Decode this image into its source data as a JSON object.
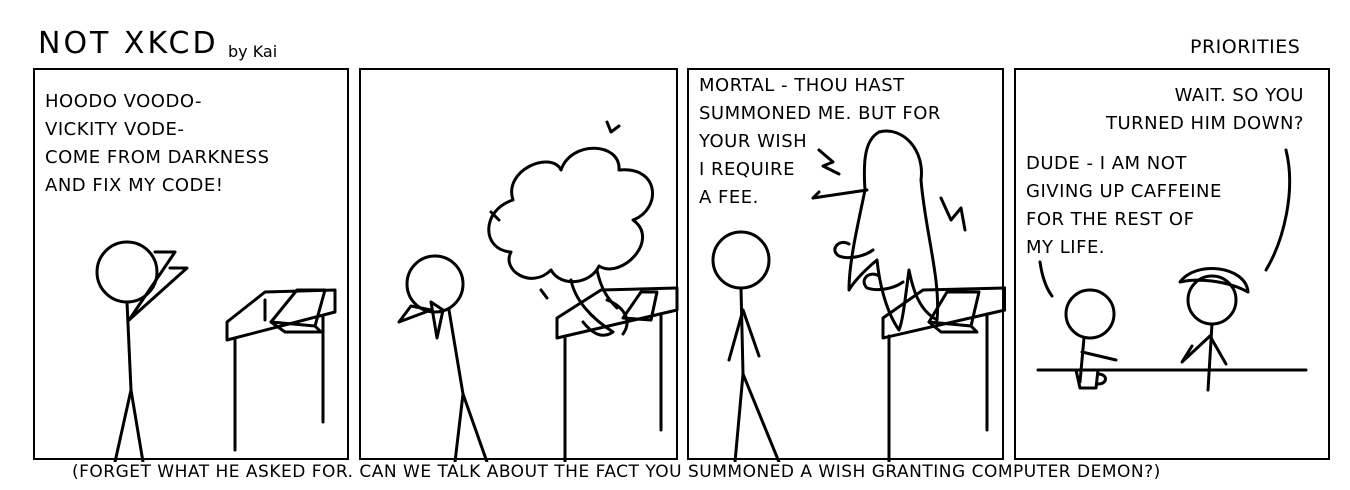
{
  "header": {
    "comic_title": "NOT XKCD",
    "author": "by Kai",
    "strip_title": "PRIORITIES"
  },
  "panels": [
    {
      "caption": "HOODO VOODO-\nVICKITY VODE-\nCOME FROM DARKNESS\nAND FIX MY  CODE!"
    },
    {
      "caption": ""
    },
    {
      "caption": "MORTAL - THOU HAST\nSUMMONED ME. BUT FOR\nYOUR WISH\nI REQUIRE\nA FEE."
    },
    {
      "caption_top": "WAIT. SO YOU\nTURNED HIM DOWN?",
      "caption_left": "DUDE - I AM NOT\nGIVING UP CAFFEINE\nFOR THE REST OF\nMY LIFE."
    }
  ],
  "footer": {
    "caption": "(FORGET WHAT HE ASKED FOR. CAN WE TALK ABOUT THE FACT YOU SUMMONED A WISH GRANTING COMPUTER DEMON?)"
  }
}
